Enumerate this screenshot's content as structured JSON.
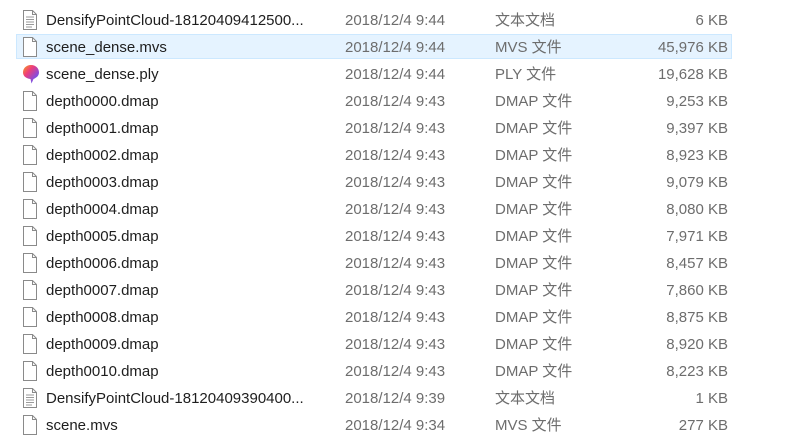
{
  "files": [
    {
      "name": "DensifyPointCloud-18120409412500...",
      "date": "2018/12/4 9:44",
      "type": "文本文档",
      "size": "6 KB",
      "icon": "text-document-icon"
    },
    {
      "name": "scene_dense.mvs",
      "date": "2018/12/4 9:44",
      "type": "MVS 文件",
      "size": "45,976 KB",
      "icon": "blank-file-icon",
      "selected": true
    },
    {
      "name": "scene_dense.ply",
      "date": "2018/12/4 9:44",
      "type": "PLY 文件",
      "size": "19,628 KB",
      "icon": "paint-3d-icon"
    },
    {
      "name": "depth0000.dmap",
      "date": "2018/12/4 9:43",
      "type": "DMAP 文件",
      "size": "9,253 KB",
      "icon": "blank-file-icon"
    },
    {
      "name": "depth0001.dmap",
      "date": "2018/12/4 9:43",
      "type": "DMAP 文件",
      "size": "9,397 KB",
      "icon": "blank-file-icon"
    },
    {
      "name": "depth0002.dmap",
      "date": "2018/12/4 9:43",
      "type": "DMAP 文件",
      "size": "8,923 KB",
      "icon": "blank-file-icon"
    },
    {
      "name": "depth0003.dmap",
      "date": "2018/12/4 9:43",
      "type": "DMAP 文件",
      "size": "9,079 KB",
      "icon": "blank-file-icon"
    },
    {
      "name": "depth0004.dmap",
      "date": "2018/12/4 9:43",
      "type": "DMAP 文件",
      "size": "8,080 KB",
      "icon": "blank-file-icon"
    },
    {
      "name": "depth0005.dmap",
      "date": "2018/12/4 9:43",
      "type": "DMAP 文件",
      "size": "7,971 KB",
      "icon": "blank-file-icon"
    },
    {
      "name": "depth0006.dmap",
      "date": "2018/12/4 9:43",
      "type": "DMAP 文件",
      "size": "8,457 KB",
      "icon": "blank-file-icon"
    },
    {
      "name": "depth0007.dmap",
      "date": "2018/12/4 9:43",
      "type": "DMAP 文件",
      "size": "7,860 KB",
      "icon": "blank-file-icon"
    },
    {
      "name": "depth0008.dmap",
      "date": "2018/12/4 9:43",
      "type": "DMAP 文件",
      "size": "8,875 KB",
      "icon": "blank-file-icon"
    },
    {
      "name": "depth0009.dmap",
      "date": "2018/12/4 9:43",
      "type": "DMAP 文件",
      "size": "8,920 KB",
      "icon": "blank-file-icon"
    },
    {
      "name": "depth0010.dmap",
      "date": "2018/12/4 9:43",
      "type": "DMAP 文件",
      "size": "8,223 KB",
      "icon": "blank-file-icon"
    },
    {
      "name": "DensifyPointCloud-18120409390400...",
      "date": "2018/12/4 9:39",
      "type": "文本文档",
      "size": "1 KB",
      "icon": "text-document-icon"
    },
    {
      "name": "scene.mvs",
      "date": "2018/12/4 9:34",
      "type": "MVS 文件",
      "size": "277 KB",
      "icon": "blank-file-icon"
    }
  ]
}
